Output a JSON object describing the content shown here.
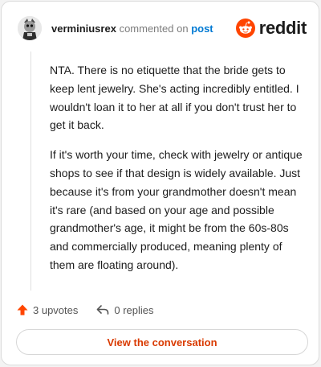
{
  "comment": {
    "username": "verminiusrex",
    "action_text": "commented on",
    "post_link": "post",
    "paragraphs": [
      "NTA. There is no etiquette that the bride gets to keep lent jewelry. She's acting incredibly entitled. I wouldn't loan it to her at all if you don't trust her to get it back.",
      "If it's worth your time, check with jewelry or antique shops to see if that design is widely available. Just because it's from your grandmother doesn't mean it's rare (and based on your age and possible grandmother's age, it might be from the 60s-80s and commercially produced, meaning plenty of them are floating around)."
    ]
  },
  "brand": {
    "wordmark": "reddit",
    "icon": "reddit-alien-icon",
    "color": "#ff4500"
  },
  "stats": {
    "upvotes": "3 upvotes",
    "replies": "0 replies"
  },
  "cta": {
    "label": "View the conversation"
  },
  "colors": {
    "accent": "#d93a00",
    "upvote": "#ff4500",
    "link": "#0079d3"
  }
}
